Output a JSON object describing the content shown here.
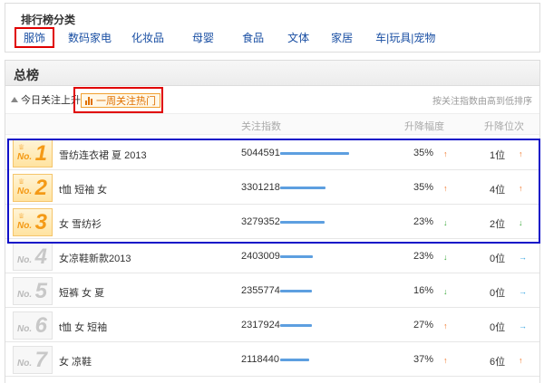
{
  "category_panel": {
    "title": "排行榜分类",
    "tabs": [
      {
        "label": "服饰",
        "active": true
      },
      {
        "label": "数码家电",
        "active": false
      },
      {
        "label": "化妆品",
        "active": false
      },
      {
        "label": "母婴",
        "active": false
      },
      {
        "label": "食品",
        "active": false
      },
      {
        "label": "文体",
        "active": false
      },
      {
        "label": "家居",
        "active": false
      },
      {
        "label": "车|玩具|宠物",
        "active": false
      }
    ]
  },
  "main": {
    "title": "总榜",
    "toolbar": {
      "today_label": "今日关注上升",
      "week_label": "一周关注热门",
      "sort_note": "按关注指数由高到低排序"
    },
    "columns": {
      "index": "关注指数",
      "change": "升降幅度",
      "rank_change": "升降位次"
    },
    "rows": [
      {
        "no": "No.",
        "rank": "1",
        "name": "雪纺连衣裙 夏 2013",
        "score": "5044591",
        "score_value": 5044591,
        "pct": "35%",
        "pct_dir": "up",
        "pos": "1位",
        "pos_dir": "up"
      },
      {
        "no": "No.",
        "rank": "2",
        "name": "t恤 短袖 女",
        "score": "3301218",
        "score_value": 3301218,
        "pct": "35%",
        "pct_dir": "up",
        "pos": "4位",
        "pos_dir": "up"
      },
      {
        "no": "No.",
        "rank": "3",
        "name": "女 雪纺衫",
        "score": "3279352",
        "score_value": 3279352,
        "pct": "23%",
        "pct_dir": "down",
        "pos": "2位",
        "pos_dir": "down"
      },
      {
        "no": "No.",
        "rank": "4",
        "name": "女凉鞋新款2013",
        "score": "2403009",
        "score_value": 2403009,
        "pct": "23%",
        "pct_dir": "down",
        "pos": "0位",
        "pos_dir": "flat"
      },
      {
        "no": "No.",
        "rank": "5",
        "name": "短裤 女 夏",
        "score": "2355774",
        "score_value": 2355774,
        "pct": "16%",
        "pct_dir": "down",
        "pos": "0位",
        "pos_dir": "flat"
      },
      {
        "no": "No.",
        "rank": "6",
        "name": "t恤 女 短袖",
        "score": "2317924",
        "score_value": 2317924,
        "pct": "27%",
        "pct_dir": "up",
        "pos": "0位",
        "pos_dir": "flat"
      },
      {
        "no": "No.",
        "rank": "7",
        "name": "女 凉鞋",
        "score": "2118440",
        "score_value": 2118440,
        "pct": "37%",
        "pct_dir": "up",
        "pos": "6位",
        "pos_dir": "up"
      }
    ]
  },
  "colors": {
    "link_blue": "#1a4fa3",
    "highlight_red": "#e00000",
    "highlight_blue": "#1010c8",
    "bar_blue": "#5d9fe0",
    "up_orange": "#f07020",
    "down_green": "#3aa83a",
    "flat_blue": "#2aa0e0"
  },
  "icons": {
    "up": "arrow-up-icon",
    "down": "arrow-down-icon",
    "flat": "arrow-right-icon"
  }
}
